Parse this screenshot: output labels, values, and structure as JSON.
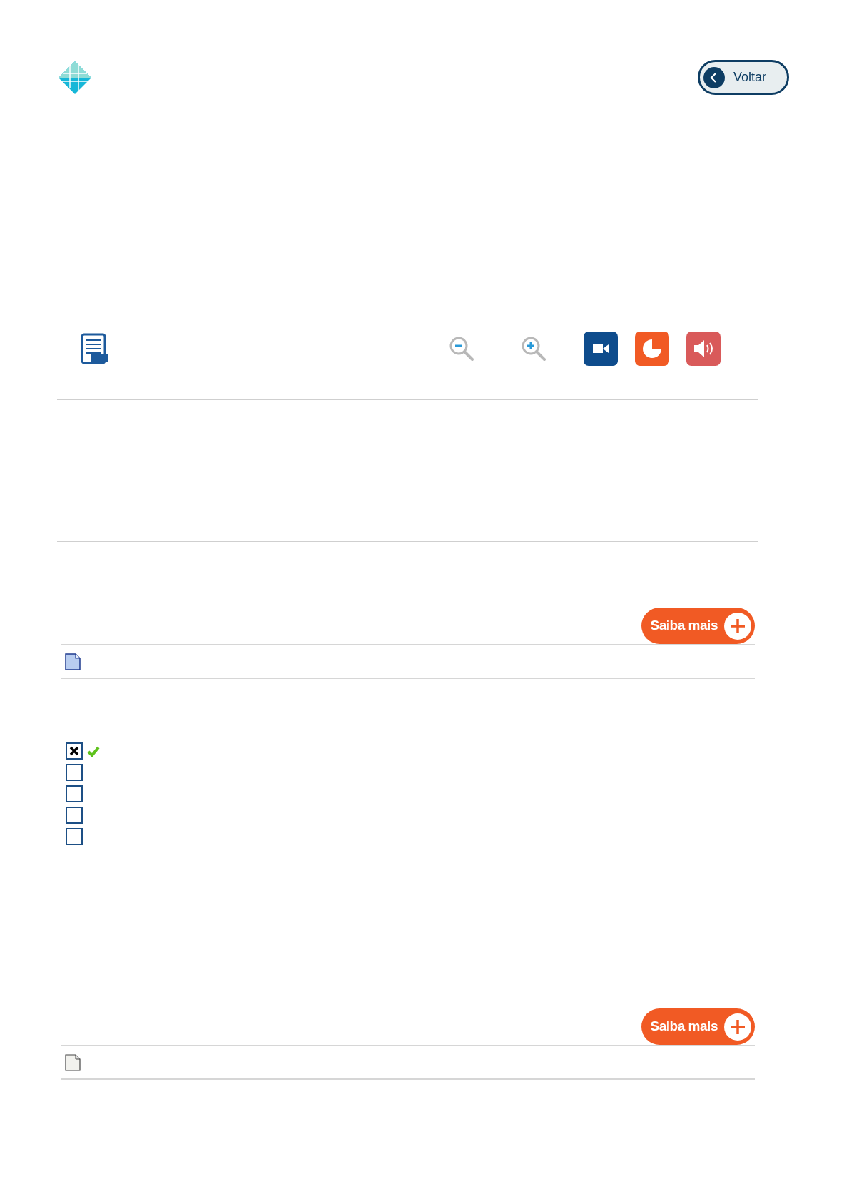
{
  "header": {
    "back_button": {
      "label": "Voltar"
    }
  },
  "sections": [
    {
      "more_button": {
        "label": "Saiba mais"
      },
      "attachment": {
        "kind": "document"
      }
    },
    {
      "more_button": {
        "label": "Saiba mais"
      },
      "attachment": {
        "kind": "blank"
      }
    }
  ],
  "options": [
    {
      "checked": true,
      "correct": true
    },
    {
      "checked": false,
      "correct": false
    },
    {
      "checked": false,
      "correct": false
    },
    {
      "checked": false,
      "correct": false
    },
    {
      "checked": false,
      "correct": false
    }
  ]
}
